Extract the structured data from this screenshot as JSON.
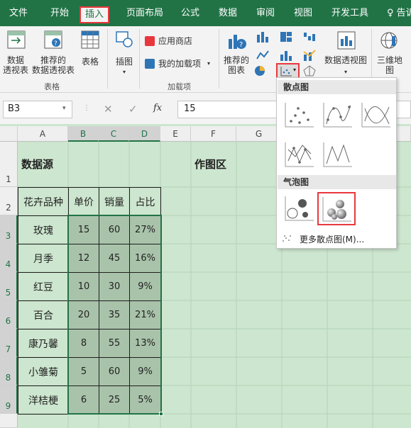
{
  "tabs": [
    "文件",
    "开始",
    "插入",
    "页面布局",
    "公式",
    "数据",
    "审阅",
    "视图",
    "开发工具",
    "告诉"
  ],
  "ribbon": {
    "pivot_table": "数据\n透视表",
    "recommended_pivot": "推荐的\n数据透视表",
    "table": "表格",
    "illustrations": "插图",
    "app_store": "应用商店",
    "my_addins": "我的加载项",
    "recommended_charts": "推荐的\n图表",
    "pivot_chart": "数据透视图",
    "map_3d": "三维地\n图",
    "group_tables": "表格",
    "group_addins": "加载项"
  },
  "formula": {
    "name_box": "B3",
    "value": "15"
  },
  "columns": [
    "A",
    "B",
    "C",
    "D",
    "E",
    "F",
    "G"
  ],
  "rows": [
    "1",
    "2",
    "3",
    "4",
    "5",
    "6",
    "7",
    "8",
    "9"
  ],
  "sheet": {
    "title_left": "数据源",
    "title_right": "作图区",
    "headers": [
      "花卉品种",
      "单价",
      "销量",
      "占比"
    ],
    "data": [
      [
        "玫瑰",
        "15",
        "60",
        "27%"
      ],
      [
        "月季",
        "12",
        "45",
        "16%"
      ],
      [
        "红豆",
        "10",
        "30",
        "9%"
      ],
      [
        "百合",
        "20",
        "35",
        "21%"
      ],
      [
        "康乃馨",
        "8",
        "55",
        "13%"
      ],
      [
        "小雏菊",
        "5",
        "60",
        "9%"
      ],
      [
        "洋桔梗",
        "6",
        "25",
        "5%"
      ]
    ]
  },
  "dropdown": {
    "scatter_header": "散点图",
    "bubble_header": "气泡图",
    "more": "更多散点图(M)..."
  },
  "colors": {
    "brand": "#217346",
    "highlight": "#e8383d",
    "sheet_bg": "#cde6cf",
    "selection": "#a9c3aa"
  }
}
